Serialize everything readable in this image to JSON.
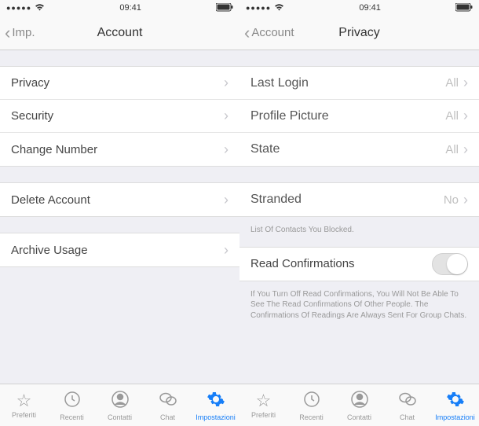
{
  "status": {
    "signal": "●●●●●",
    "time": "09:41"
  },
  "left": {
    "nav": {
      "back": "Imp.",
      "title": "Account"
    },
    "group1": [
      {
        "label": "Privacy"
      },
      {
        "label": "Security"
      },
      {
        "label": "Change Number"
      }
    ],
    "group2": [
      {
        "label": "Delete Account"
      }
    ],
    "group3": [
      {
        "label": "Archive Usage"
      }
    ]
  },
  "right": {
    "nav": {
      "back": "Account",
      "title": "Privacy"
    },
    "groupA": [
      {
        "label": "Last Login",
        "value": "All"
      },
      {
        "label": "Profile Picture",
        "value": "All"
      },
      {
        "label": "State",
        "value": "All"
      }
    ],
    "groupB": [
      {
        "label": "Stranded",
        "value": "No"
      }
    ],
    "blocked_note": "List Of Contacts You Blocked.",
    "read_confirm": "Read Confirmations",
    "read_note": "If You Turn Off Read Confirmations, You Will Not Be Able To See The Read Confirmations Of Other People. The Confirmations Of Readings Are Always Sent For Group Chats."
  },
  "tabs": {
    "preferiti": "Preferiti",
    "recenti": "Recenti",
    "contatti": "Contatti",
    "chat": "Chat",
    "impostazioni": "Impostazioni"
  }
}
